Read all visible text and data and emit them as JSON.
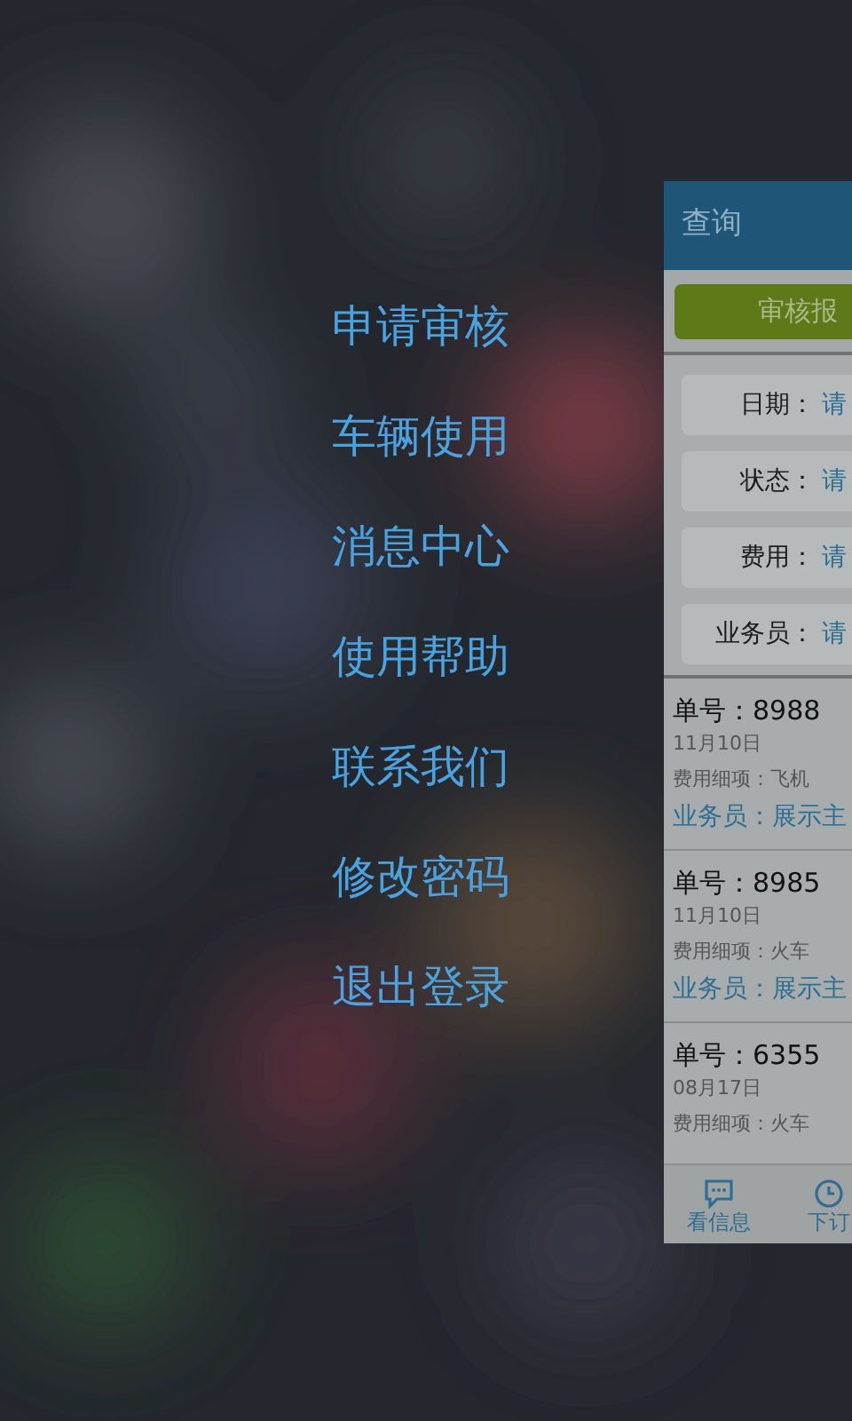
{
  "menu": [
    {
      "label": "申请审核"
    },
    {
      "label": "车辆使用"
    },
    {
      "label": "消息中心"
    },
    {
      "label": "使用帮助"
    },
    {
      "label": "联系我们"
    },
    {
      "label": "修改密码"
    },
    {
      "label": "退出登录"
    }
  ],
  "panel": {
    "title": "查询",
    "action_button": "审核报",
    "filters": [
      {
        "label": "日期：",
        "placeholder": "请"
      },
      {
        "label": "状态：",
        "placeholder": "请"
      },
      {
        "label": "费用：",
        "placeholder": "请"
      },
      {
        "label": "业务员：",
        "placeholder": "请"
      }
    ],
    "orders": [
      {
        "number": "单号：8988",
        "date": "11月10日",
        "detail": "费用细项：飞机",
        "salesperson": "业务员：展示主"
      },
      {
        "number": "单号：8985",
        "date": "11月10日",
        "detail": "费用细项：火车",
        "salesperson": "业务员：展示主"
      },
      {
        "number": "单号：6355",
        "date": "08月17日",
        "detail": "费用细项：火车"
      }
    ],
    "tabs": [
      {
        "label": "看信息",
        "kind": "chat"
      },
      {
        "label": "下订",
        "kind": "clock"
      }
    ]
  }
}
